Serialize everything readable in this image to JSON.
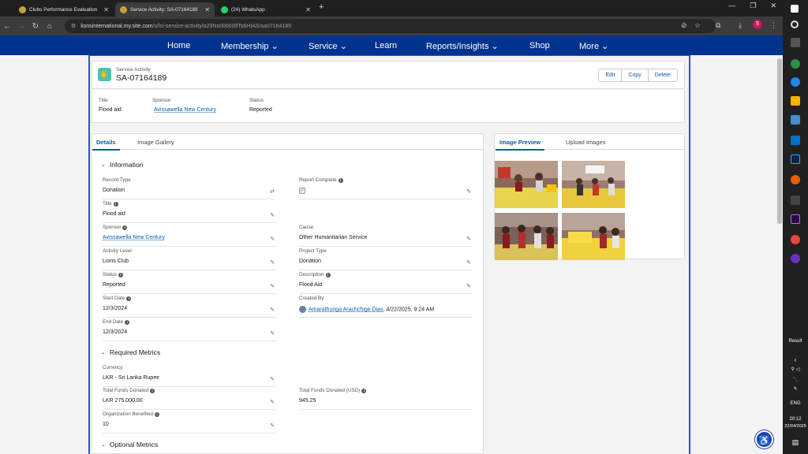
{
  "browser": {
    "tabs": [
      {
        "title": "Clubs Performance Evaluation",
        "icon": "lions-logo-icon"
      },
      {
        "title": "Service Activity: SA-07164189",
        "icon": "lions-logo-icon"
      },
      {
        "title": "(24) WhatsApp",
        "icon": "whatsapp-icon"
      }
    ],
    "url_host": "lionsinternational.my.site.com",
    "url_path": "/s/lci-service-activity/a29Ns000009Ts6HIAS/sa07164189",
    "profile_initial": "S"
  },
  "site_nav": {
    "items": [
      "Home",
      "Membership ⌄",
      "Service ⌄",
      "Learn",
      "Reports/Insights ⌄",
      "Shop",
      "More ⌄"
    ]
  },
  "record": {
    "type_label": "Service Activity",
    "number": "SA-07164189",
    "buttons": [
      "Edit",
      "Copy",
      "Delete"
    ],
    "summary": [
      {
        "label": "Title",
        "value": "Flood aid"
      },
      {
        "label": "Sponsor",
        "value": "Avissawella New Century"
      },
      {
        "label": "Status",
        "value": "Reported"
      }
    ]
  },
  "left_tabs": [
    "Details",
    "Image Gallery"
  ],
  "right_tabs": [
    "Image Preview",
    "Upload Images"
  ],
  "sections": {
    "information": "Information",
    "required": "Required Metrics",
    "optional": "Optional Metrics"
  },
  "fields": {
    "record_type": {
      "label": "Record Type",
      "value": "Donation"
    },
    "report_complete": {
      "label": "Report Complete",
      "value": "✓"
    },
    "title": {
      "label": "Title",
      "value": "Flood aid"
    },
    "sponsor": {
      "label": "Sponsor",
      "value": "Avissawella New Century"
    },
    "cause": {
      "label": "Cause",
      "value": "Other Humanitarian Service"
    },
    "activity_level": {
      "label": "Activity Level",
      "value": "Lions Club"
    },
    "project_type": {
      "label": "Project Type",
      "value": "Donation"
    },
    "status": {
      "label": "Status",
      "value": "Reported"
    },
    "description": {
      "label": "Description",
      "value": "Flood Aid"
    },
    "start_date": {
      "label": "Start Date",
      "value": "12/3/2024"
    },
    "created_by": {
      "label": "Created By",
      "name": "Amarathunga Arachchige Dias",
      "date": ", 4/22/2025, 9:24 AM"
    },
    "end_date": {
      "label": "End Date",
      "value": "12/3/2024"
    },
    "currency": {
      "label": "Currency",
      "value": "LKR - Sri Lanka Rupee"
    },
    "funds_donated": {
      "label": "Total Funds Donated",
      "value": "LKR 275,000.00"
    },
    "funds_donated_usd": {
      "label": "Total Funds Donated (USD)",
      "value": "945.25"
    },
    "org_benefited": {
      "label": "Organization Benefited",
      "value": "10"
    }
  },
  "taskbar": {
    "result_label": "Result",
    "lang": "ENG",
    "time": "20:12",
    "date": "22/04/2025"
  }
}
